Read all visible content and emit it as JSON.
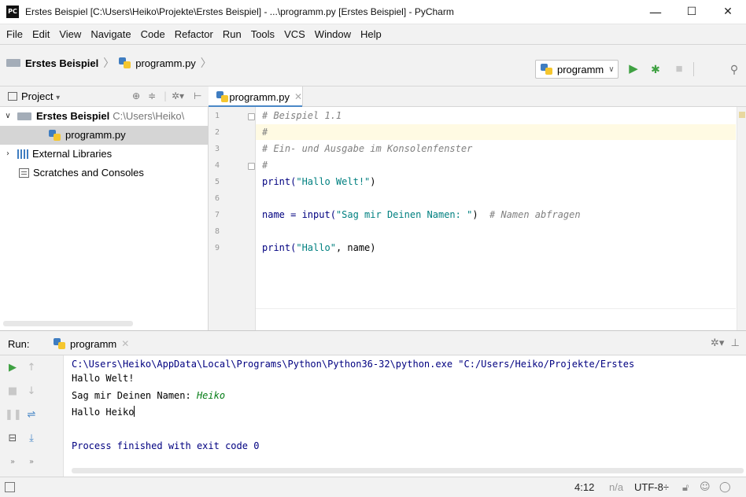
{
  "window": {
    "title": "Erstes Beispiel [C:\\Users\\Heiko\\Projekte\\Erstes Beispiel] - ...\\programm.py [Erstes Beispiel] - PyCharm",
    "app_icon_text": "PC",
    "minimize_glyph": "—",
    "maximize_glyph": "☐",
    "close_glyph": "✕"
  },
  "menu": [
    "File",
    "Edit",
    "View",
    "Navigate",
    "Code",
    "Refactor",
    "Run",
    "Tools",
    "VCS",
    "Window",
    "Help"
  ],
  "navbar": {
    "project": "Erstes Beispiel",
    "file": "programm.py",
    "run_config": "programm"
  },
  "project_panel": {
    "label": "Project",
    "tree": {
      "root_name": "Erstes Beispiel",
      "root_path": "C:\\Users\\Heiko\\",
      "file": "programm.py",
      "libraries": "External Libraries",
      "scratches": "Scratches and Consoles"
    }
  },
  "editor": {
    "tab_label": "programm.py",
    "line_numbers": [
      "1",
      "2",
      "3",
      "4",
      "5",
      "6",
      "7",
      "8",
      "9"
    ],
    "lines": {
      "l1": "# Beispiel 1.1",
      "l2": "#",
      "l3": "# Ein- und Ausgabe im Konsolenfenster",
      "l4": "#",
      "l5_fn": "print(",
      "l5_str": "\"Hallo Welt!\"",
      "l5_end": ")",
      "l7_pre": "name = input(",
      "l7_str": "\"Sag mir Deinen Namen: \"",
      "l7_end": ")  ",
      "l7_cmt": "# Namen abfragen",
      "l9_fn": "print(",
      "l9_str": "\"Hallo\"",
      "l9_end": ", name)"
    }
  },
  "run_panel": {
    "label": "Run:",
    "tab_label": "programm",
    "console": {
      "command": "C:\\Users\\Heiko\\AppData\\Local\\Programs\\Python\\Python36-32\\python.exe \"C:/Users/Heiko/Projekte/Erstes",
      "out1": "Hallo Welt!",
      "prompt": "Sag mir Deinen Namen: ",
      "input": "Heiko",
      "out2": "Hallo Heiko",
      "exit": "Process finished with exit code 0"
    }
  },
  "statusbar": {
    "position": "4:12",
    "line_sep": "n/a",
    "encoding": "UTF-8÷"
  },
  "colors": {
    "accent": "#4a88c7",
    "run_green": "#3fa142",
    "string_green": "#067d17",
    "comment_gray": "#808080"
  }
}
